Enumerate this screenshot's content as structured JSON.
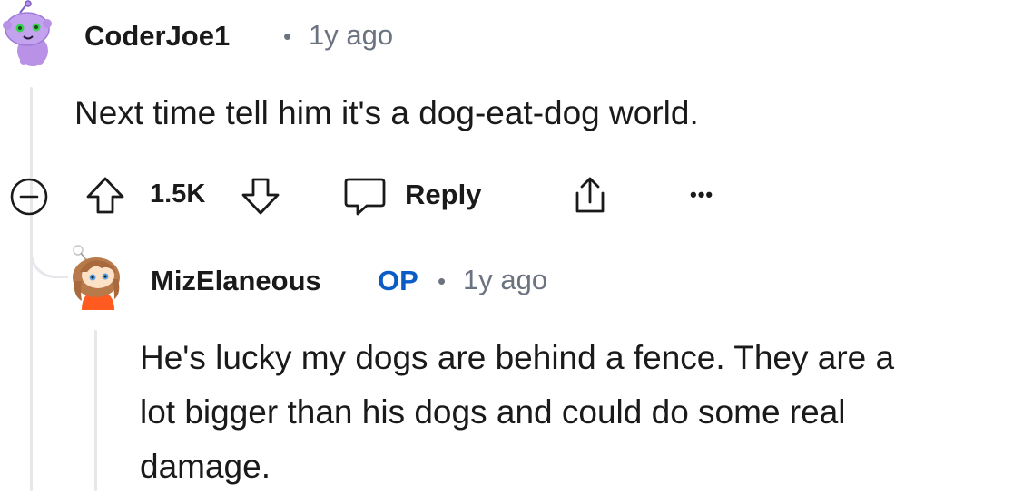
{
  "comment": {
    "username": "CoderJoe1",
    "time_ago": "1y ago",
    "body": "Next time tell him it's a dog-eat-dog world.",
    "votes": "1.5K",
    "reply_label": "Reply",
    "more_label": "•••"
  },
  "reply": {
    "username": "MizElaneous",
    "op_badge": "OP",
    "time_ago": "1y ago",
    "body_lines": [
      "He's lucky my dogs are behind a fence. They are a",
      "lot bigger than his dogs and could do some real",
      "damage."
    ]
  },
  "icons": {
    "collapse": "collapse-minus-icon",
    "upvote": "upvote-arrow-icon",
    "downvote": "downvote-arrow-icon",
    "reply": "speech-bubble-icon",
    "share": "share-icon",
    "more": "more-dots-icon"
  },
  "colors": {
    "op_badge": "#0b5cc7",
    "meta_text": "#6b7280",
    "thread_line": "#e5e7eb",
    "avatar1_body": "#b991e6",
    "avatar2_shirt": "#ff5a1f"
  }
}
